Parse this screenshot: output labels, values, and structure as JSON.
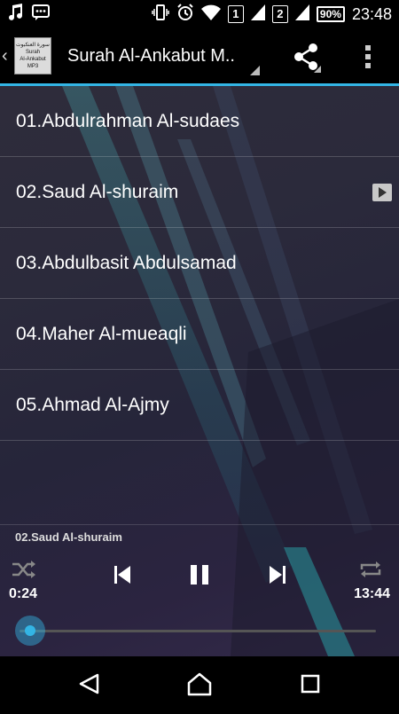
{
  "status_bar": {
    "sim1": "1",
    "sim2": "2",
    "battery": "90%",
    "time": "23:48"
  },
  "header": {
    "logo_text_ar": "سورة العنكبوت",
    "logo_text_1": "Surah",
    "logo_text_2": "Al-Ankabut MP3",
    "title": "Surah Al-Ankabut M.."
  },
  "tracks": [
    {
      "label": "01.Abdulrahman Al-sudaes",
      "playing": false
    },
    {
      "label": "02.Saud Al-shuraim",
      "playing": true
    },
    {
      "label": "03.Abdulbasit Abdulsamad",
      "playing": false
    },
    {
      "label": "04.Maher Al-mueaqli",
      "playing": false
    },
    {
      "label": "05.Ahmad Al-Ajmy",
      "playing": false
    }
  ],
  "player": {
    "now_playing": "02.Saud Al-shuraim",
    "elapsed": "0:24",
    "duration": "13:44",
    "progress_fraction": 0.03
  },
  "colors": {
    "accent": "#33b5e5"
  },
  "icons": [
    "music-note-icon",
    "messages-icon",
    "vibrate-icon",
    "alarm-icon",
    "wifi-icon",
    "signal-icon",
    "share-icon",
    "overflow-menu-icon",
    "shuffle-icon",
    "previous-icon",
    "pause-icon",
    "next-icon",
    "repeat-icon",
    "back-icon",
    "home-icon",
    "recents-icon"
  ]
}
